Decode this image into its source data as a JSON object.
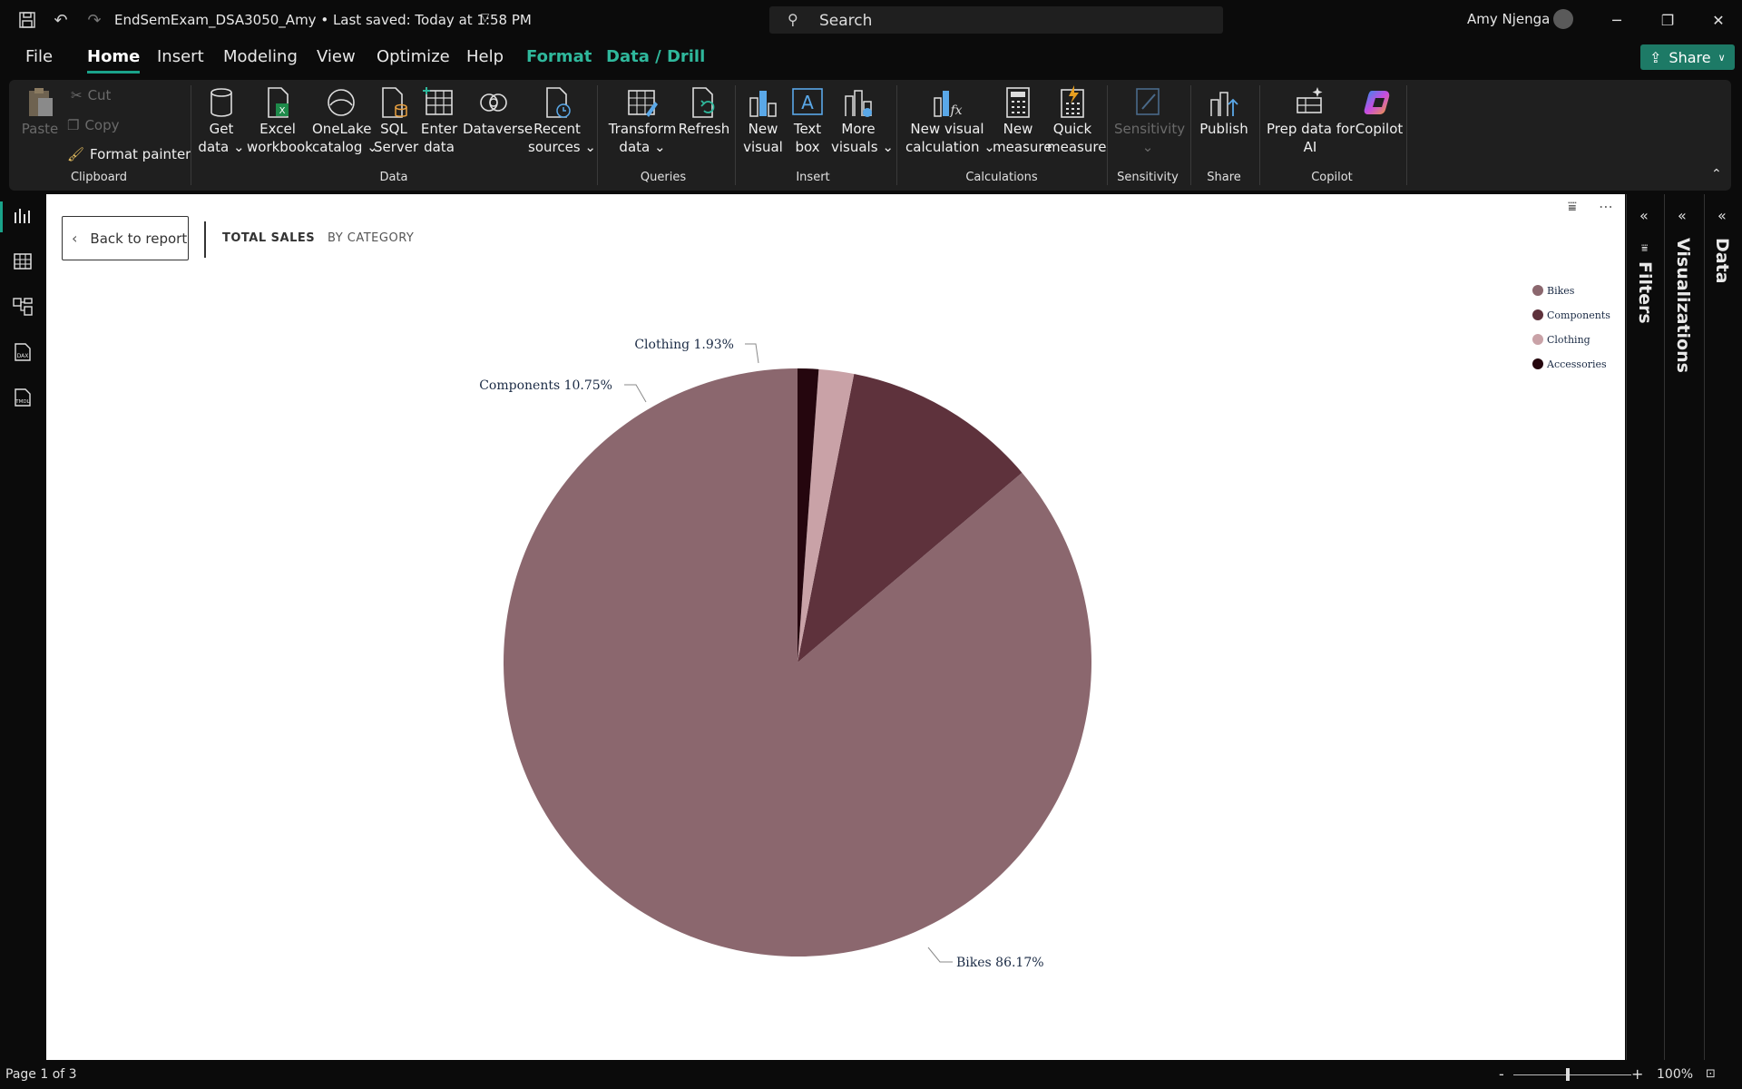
{
  "titlebar": {
    "doc_title": "EndSemExam_DSA3050_Amy • Last saved: Today at 1:58 PM",
    "search_placeholder": "Search",
    "user_name": "Amy Njenga"
  },
  "menu": {
    "items": [
      {
        "label": "File"
      },
      {
        "label": "Home"
      },
      {
        "label": "Insert"
      },
      {
        "label": "Modeling"
      },
      {
        "label": "View"
      },
      {
        "label": "Optimize"
      },
      {
        "label": "Help"
      },
      {
        "label": "Format"
      },
      {
        "label": "Data / Drill"
      }
    ],
    "active": "Home",
    "share_label": "Share"
  },
  "ribbon": {
    "clipboard": {
      "paste": "Paste",
      "cut": "Cut",
      "copy": "Copy",
      "format_painter": "Format painter",
      "group": "Clipboard"
    },
    "data": {
      "get_data_1": "Get",
      "get_data_2": "data",
      "excel_1": "Excel",
      "excel_2": "workbook",
      "onelake_1": "OneLake",
      "onelake_2": "catalog",
      "sql_1": "SQL",
      "sql_2": "Server",
      "enter_1": "Enter",
      "enter_2": "data",
      "dataverse": "Dataverse",
      "recent_1": "Recent",
      "recent_2": "sources",
      "group": "Data"
    },
    "queries": {
      "transform_1": "Transform",
      "transform_2": "data",
      "refresh": "Refresh",
      "group": "Queries"
    },
    "insert": {
      "new_visual_1": "New",
      "new_visual_2": "visual",
      "text_box_1": "Text",
      "text_box_2": "box",
      "more_visuals_1": "More",
      "more_visuals_2": "visuals",
      "group": "Insert"
    },
    "calculations": {
      "new_visual_calc_1": "New visual",
      "new_visual_calc_2": "calculation",
      "new_measure_1": "New",
      "new_measure_2": "measure",
      "quick_measure_1": "Quick",
      "quick_measure_2": "measure",
      "group": "Calculations"
    },
    "sensitivity": {
      "label": "Sensitivity",
      "group": "Sensitivity"
    },
    "share": {
      "publish": "Publish",
      "group": "Share"
    },
    "copilot": {
      "prep_1": "Prep data for",
      "prep_2": "AI",
      "copilot": "Copilot",
      "group": "Copilot"
    }
  },
  "canvas": {
    "back_label": "Back to report",
    "crumb_1": "TOTAL SALES",
    "crumb_2": "BY CATEGORY"
  },
  "chart_data": {
    "type": "pie",
    "slices": [
      {
        "name": "Bikes",
        "value": 86.17,
        "label": "Bikes 86.17%",
        "color": "#8b676e"
      },
      {
        "name": "Components",
        "value": 10.75,
        "label": "Components 10.75%",
        "color": "#5e323c"
      },
      {
        "name": "Clothing",
        "value": 1.93,
        "label": "Clothing 1.93%",
        "color": "#c9a2a7"
      },
      {
        "name": "Accessories",
        "value": 1.15,
        "label": "",
        "color": "#25060e"
      }
    ],
    "legend": [
      "Bikes",
      "Components",
      "Clothing",
      "Accessories"
    ],
    "legend_position": "top-right"
  },
  "panes": {
    "filters": "Filters",
    "visualizations": "Visualizations",
    "data": "Data"
  },
  "status": {
    "page": "Page 1 of 3",
    "zoom": "100%"
  },
  "colors": {
    "accent": "#1aa38a",
    "share": "#1d7a66"
  }
}
